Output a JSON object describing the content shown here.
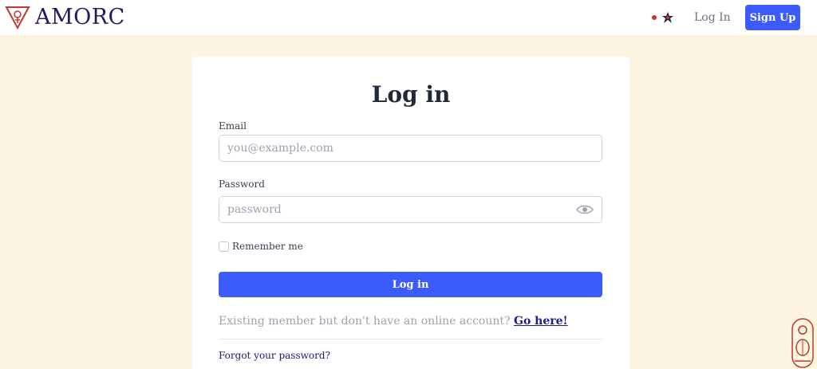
{
  "header": {
    "brand": "AMORC",
    "login_label": "Log In",
    "signup_label": "Sign Up"
  },
  "form": {
    "title": "Log in",
    "email_label": "Email",
    "email_placeholder": "you@example.com",
    "password_label": "Password",
    "password_placeholder": "password",
    "remember_label": "Remember me",
    "submit_label": "Log in",
    "existing_text": "Existing member but don't have an online account?",
    "existing_link": "Go here!",
    "forgot_label": "Forgot your password?"
  },
  "colors": {
    "background": "#fdf5e1",
    "accent": "#3b5bfd",
    "brand": "#1e1b5e"
  },
  "icons": [
    "amorc-logo-icon",
    "language-flag-icon",
    "eye-icon",
    "scarab-cartouche-icon"
  ]
}
